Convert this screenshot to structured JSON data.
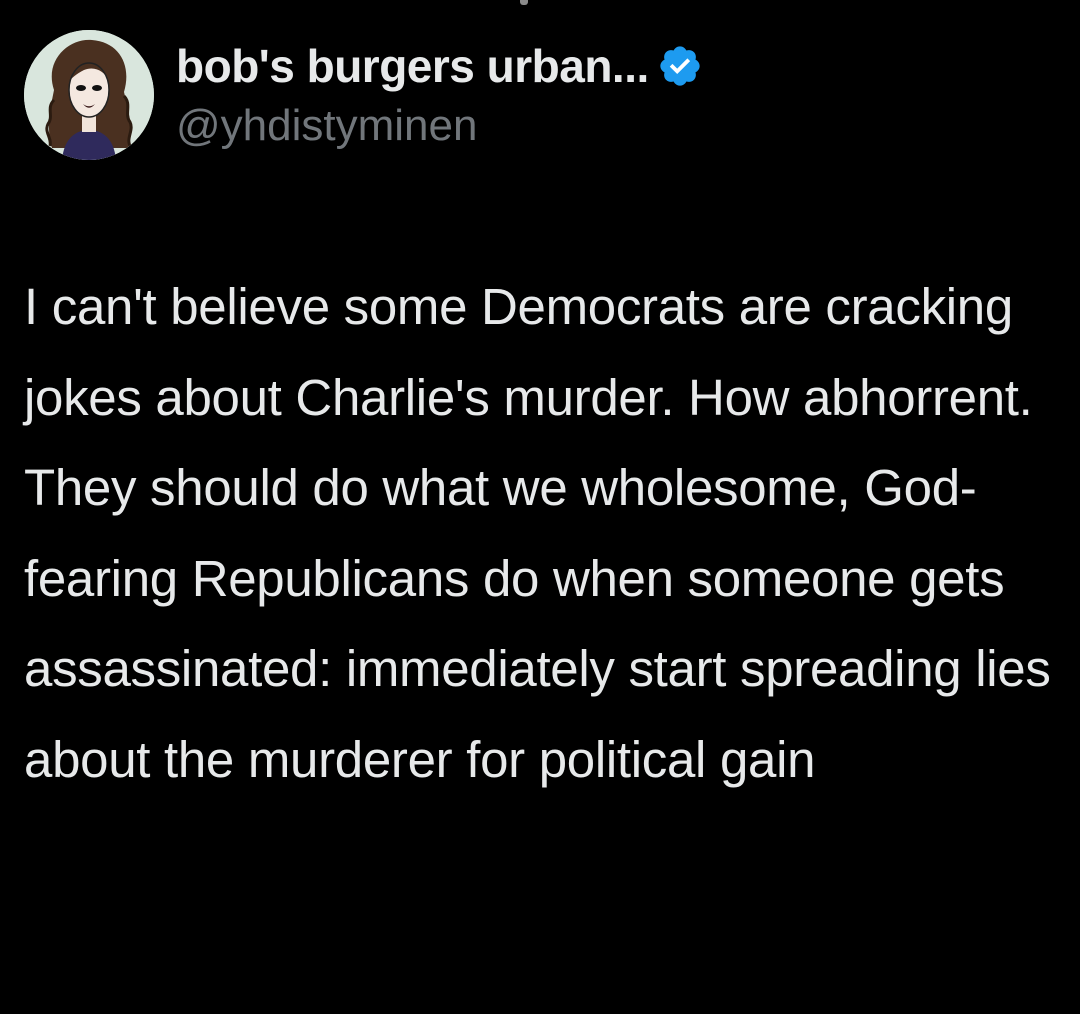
{
  "tweet": {
    "author": {
      "display_name": "bob's burgers urban...",
      "handle": "@yhdistyminen",
      "avatar_icon": "avatar-illustration-icon",
      "verified_icon": "verified-badge-icon"
    },
    "text": "I can't believe some Democrats are cracking jokes about Charlie's murder. How abhorrent. They should do what we wholesome, God-fearing Republicans do when someone gets assassinated: immediately start spreading lies about the murderer for political gain"
  },
  "colors": {
    "background": "#000000",
    "text_primary": "#e7e9ea",
    "text_secondary": "#71767b",
    "verified_blue": "#1d9bf0"
  }
}
